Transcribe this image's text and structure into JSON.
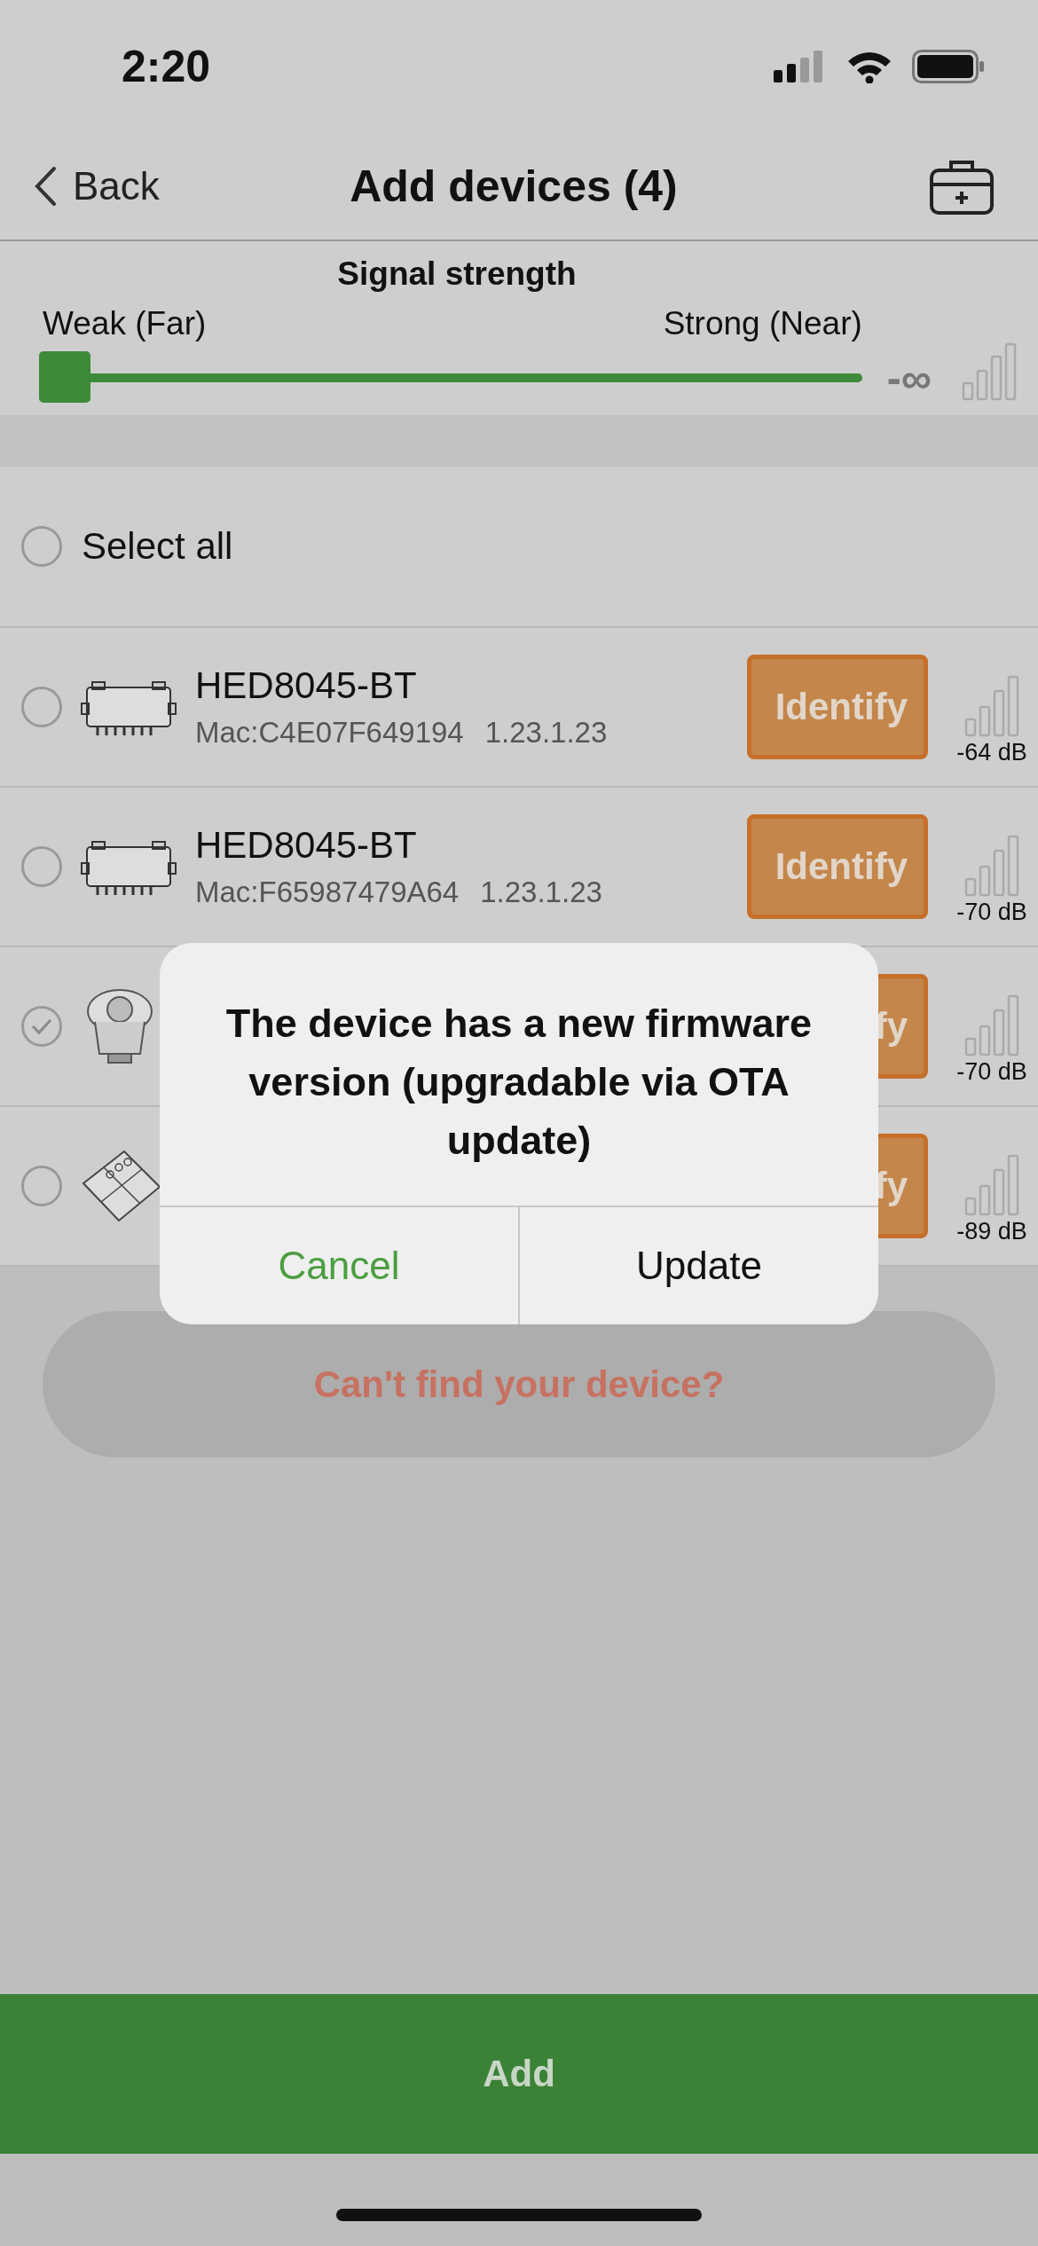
{
  "status_bar": {
    "time": "2:20"
  },
  "nav": {
    "back": "Back",
    "title": "Add devices (4)"
  },
  "signal_filter": {
    "title": "Signal strength",
    "weak_label": "Weak (Far)",
    "strong_label": "Strong (Near)",
    "level": 0,
    "reading": "-∞"
  },
  "select_all": {
    "label": "Select all",
    "checked": false
  },
  "devices": [
    {
      "kind": "module",
      "name": "HED8045-BT",
      "mac": "Mac:C4E07F649194",
      "version": "1.23.1.23",
      "checked": false,
      "identify": "Identify",
      "signal": "-64 dB"
    },
    {
      "kind": "module",
      "name": "HED8045-BT",
      "mac": "Mac:F65987479A64",
      "version": "1.23.1.23",
      "checked": false,
      "identify": "Identify",
      "signal": "-70 dB"
    },
    {
      "kind": "sensor",
      "checked": true,
      "identify": "fy",
      "signal": "-70 dB"
    },
    {
      "kind": "keypad",
      "checked": false,
      "identify": "fy",
      "signal": "-89 dB"
    }
  ],
  "help_button": "Can't find your device?",
  "add_button": "Add",
  "dialog": {
    "message": "The device has a new firmware version (upgradable via OTA update)",
    "buttons": [
      {
        "kind": "cancel",
        "label": "Cancel"
      },
      {
        "kind": "confirm",
        "label": "Update"
      }
    ]
  }
}
